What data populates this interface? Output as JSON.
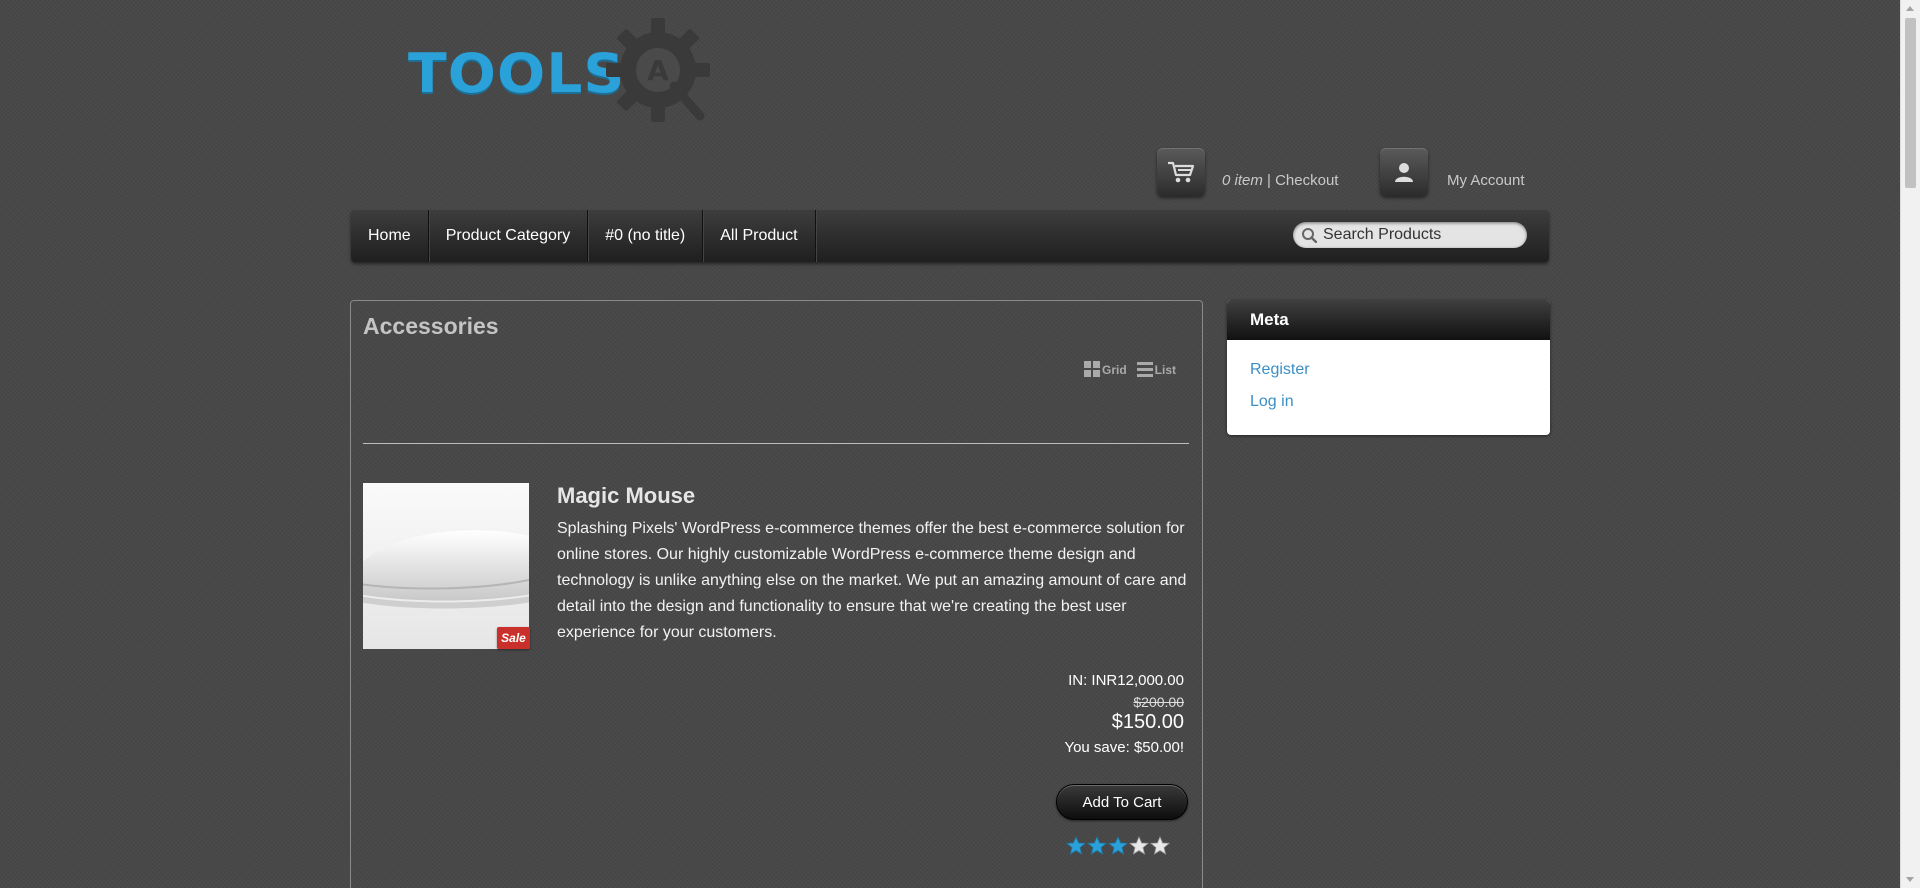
{
  "logo": {
    "text": "TOOLS",
    "letter": "A"
  },
  "header": {
    "cart_count": "0 item",
    "cart_sep": " | ",
    "checkout_label": "Checkout",
    "account_label": "My Account"
  },
  "nav": {
    "items": [
      {
        "label": "Home"
      },
      {
        "label": "Product Category"
      },
      {
        "label": "#0 (no title)"
      },
      {
        "label": "All Product"
      }
    ],
    "search_placeholder": "Search Products"
  },
  "main": {
    "title": "Accessories",
    "view_grid": "Grid",
    "view_list": "List",
    "product": {
      "name": "Magic Mouse",
      "description": "Splashing Pixels' WordPress e-commerce themes offer the best e-commerce solution for online stores. Our highly customizable WordPress e-commerce theme design and technology is unlike anything else on the market. We put an amazing amount of care and detail into the design and functionality to ensure that we're creating the best user experience for your customers.",
      "badge": "Sale",
      "price_in": "IN: INR12,000.00",
      "price_old": "$200.00",
      "price_now": "$150.00",
      "price_save": "You save: $50.00!",
      "add_to_cart": "Add To Cart",
      "rating": 3,
      "rating_max": 5
    }
  },
  "sidebar": {
    "meta_title": "Meta",
    "links": [
      {
        "label": "Register"
      },
      {
        "label": "Log in"
      }
    ]
  },
  "colors": {
    "accent": "#2aa1d8",
    "link": "#3b8fc4",
    "sale": "#c9302c"
  }
}
